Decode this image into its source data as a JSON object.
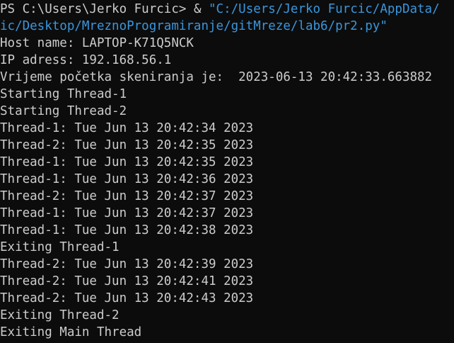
{
  "terminal": {
    "prompt": "PS C:\\Users\\Jerko Furcic> ",
    "operator": "& ",
    "command_part1": "\"C:/Users/Jerko Furcic/AppData/",
    "command_part2": "ic/Desktop/MreznoProgramiranje/gitMreze/lab6/pr2.py\"",
    "output": [
      "Host name: LAPTOP-K71Q5NCK",
      "IP adress: 192.168.56.1",
      "Vrijeme početka skeniranja je:  2023-06-13 20:42:33.663882",
      "Starting Thread-1",
      "Starting Thread-2",
      "Thread-1: Tue Jun 13 20:42:34 2023",
      "Thread-2: Tue Jun 13 20:42:35 2023",
      "Thread-1: Tue Jun 13 20:42:35 2023",
      "Thread-1: Tue Jun 13 20:42:36 2023",
      "Thread-2: Tue Jun 13 20:42:37 2023",
      "Thread-1: Tue Jun 13 20:42:37 2023",
      "Thread-1: Tue Jun 13 20:42:38 2023",
      "Exiting Thread-1",
      "Thread-2: Tue Jun 13 20:42:39 2023",
      "Thread-2: Tue Jun 13 20:42:41 2023",
      "Thread-2: Tue Jun 13 20:42:43 2023",
      "Exiting Thread-2",
      "Exiting Main Thread"
    ],
    "colors": {
      "background": "#0c0c0c",
      "text": "#cccccc",
      "command_string": "#3a96dd"
    }
  }
}
